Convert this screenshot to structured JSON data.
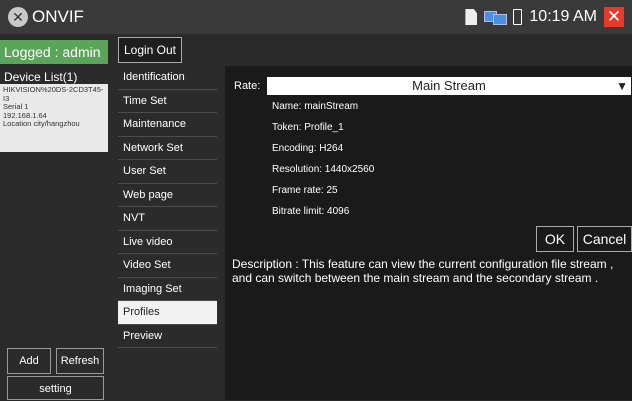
{
  "title_bar": {
    "app_name": "ONVIF",
    "app_icon_glyph": "✕",
    "time": "10:19 AM",
    "close_glyph": "✕",
    "close_color": "#e53b2a"
  },
  "left_panel": {
    "logged_in_label": "Logged : admin",
    "logged_in_color": "#5aa55a",
    "device_list_label": "Device List(1)",
    "device": {
      "name": "HIKVISION%20DS-2CD3T45-I3",
      "serial": "Serial 1",
      "ip": "192.168.1.64",
      "location": "Location city/hangzhou"
    },
    "add_label": "Add",
    "refresh_label": "Refresh",
    "setting_label": "setting"
  },
  "logout_label": "Login Out",
  "menu": {
    "items": [
      "Identification",
      "Time Set",
      "Maintenance",
      "Network Set",
      "User Set",
      "Web page",
      "NVT",
      "Live video",
      "Video Set",
      "Imaging Set",
      "Profiles",
      "Preview"
    ],
    "active": "Profiles"
  },
  "content": {
    "rate_label": "Rate:",
    "rate_value": "Main Stream",
    "name": "Name:  mainStream",
    "token": "Token:  Profile_1",
    "encoding": "Encoding:  H264",
    "resolution": "Resolution:  1440x2560",
    "frame_rate": "Frame rate:  25",
    "bitrate": "Bitrate limit:  4096",
    "ok_label": "OK",
    "cancel_label": "Cancel",
    "description": "Description : This feature can view the current configuration file stream , and can switch between the main stream and the secondary stream ."
  }
}
